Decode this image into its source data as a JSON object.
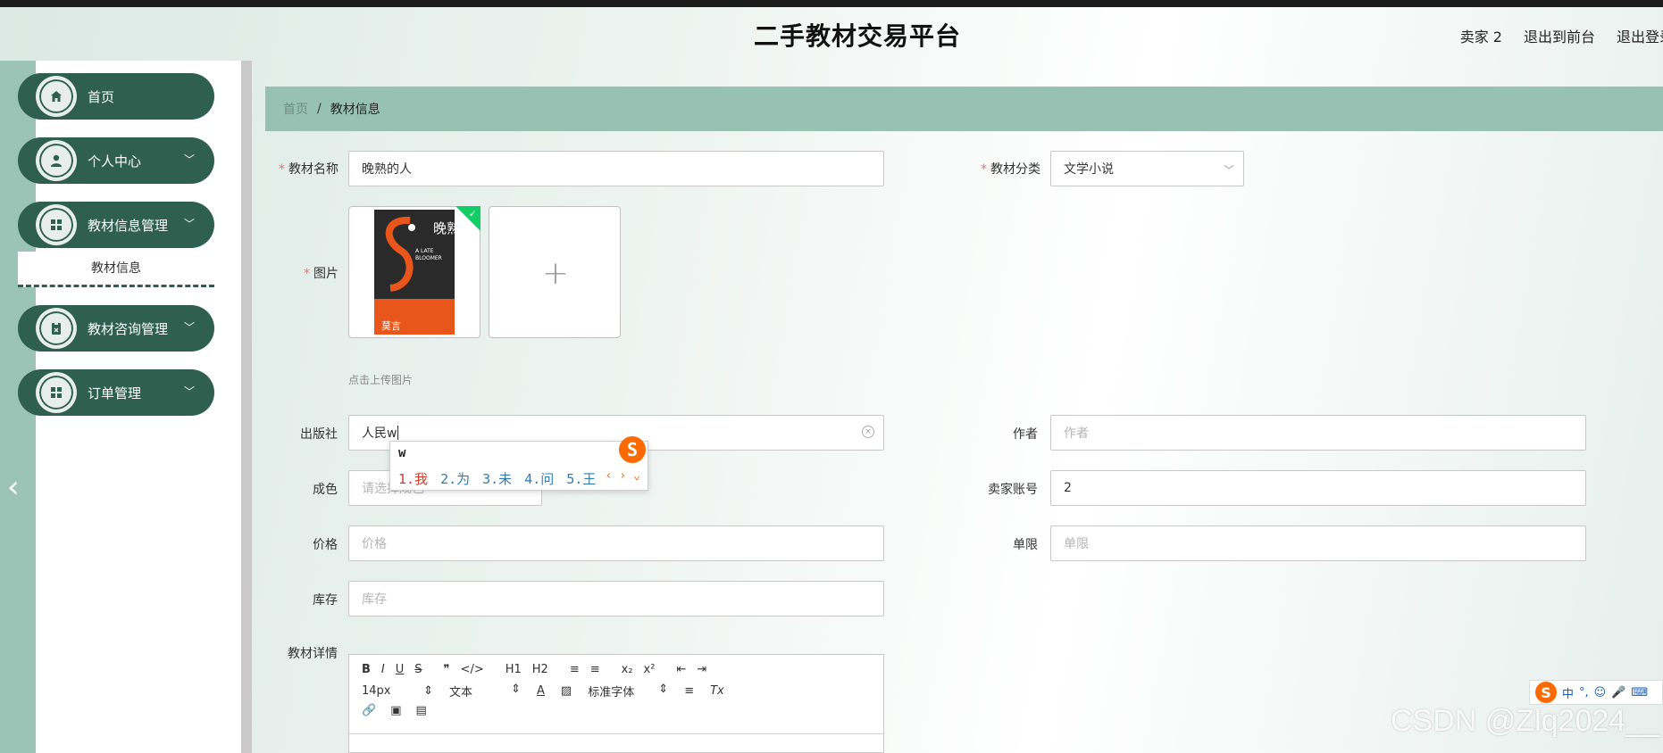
{
  "header": {
    "title": "二手教材交易平台",
    "links": [
      "卖家 2",
      "退出到前台",
      "退出登录"
    ]
  },
  "sidebar": {
    "items": [
      {
        "label": "首页",
        "icon": "home-icon",
        "has_children": false
      },
      {
        "label": "个人中心",
        "icon": "user-icon",
        "has_children": true
      },
      {
        "label": "教材信息管理",
        "icon": "grid-icon",
        "has_children": true,
        "expanded": true
      },
      {
        "label": "教材咨询管理",
        "icon": "clipboard-icon",
        "has_children": true
      },
      {
        "label": "订单管理",
        "icon": "grid-icon",
        "has_children": true
      }
    ],
    "submenu": {
      "label": "教材信息"
    }
  },
  "breadcrumb": {
    "home": "首页",
    "separator": "/",
    "current": "教材信息"
  },
  "form": {
    "name": {
      "label": "教材名称",
      "value": "晚熟的人",
      "required": true
    },
    "category": {
      "label": "教材分类",
      "value": "文学小说",
      "required": true
    },
    "image": {
      "label": "图片",
      "required": true,
      "hint": "点击上传图片"
    },
    "publisher": {
      "label": "出版社",
      "value": "人民w"
    },
    "author": {
      "label": "作者",
      "placeholder": "作者"
    },
    "condition": {
      "label": "成色",
      "placeholder": "请选择成色"
    },
    "seller": {
      "label": "卖家账号",
      "value": "2"
    },
    "price": {
      "label": "价格",
      "placeholder": "价格"
    },
    "limit": {
      "label": "单限",
      "placeholder": "单限"
    },
    "stock": {
      "label": "库存",
      "placeholder": "库存"
    },
    "details": {
      "label": "教材详情"
    }
  },
  "cover": {
    "title": "晚熟的人",
    "subtitle": "A LATE BLOOMER",
    "author": "莫言"
  },
  "ime": {
    "input": "w",
    "candidates": [
      "1.我",
      "2.为",
      "3.未",
      "4.问",
      "5.王"
    ]
  },
  "editor": {
    "row1": [
      "B",
      "I",
      "U",
      "S",
      "❞",
      "</>",
      "H1",
      "H2",
      "≡",
      "≡",
      "x₂",
      "x²",
      "⇤",
      "⇥"
    ],
    "font_size": "14px",
    "text_type": "文本",
    "font_family": "标准字体"
  },
  "tray": {
    "lang": "中"
  },
  "watermark": "CSDN @Zlq2024__"
}
